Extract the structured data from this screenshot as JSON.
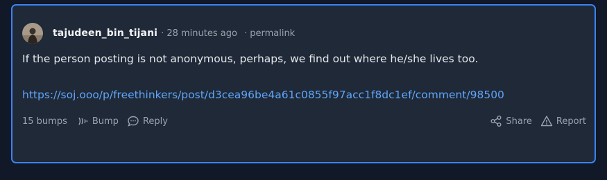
{
  "comment": {
    "username": "tajudeen_bin_tijani",
    "time": "· 28 minutes ago",
    "permalink": "· permalink",
    "body": "If the person posting is not anonymous, perhaps, we find out where he/she lives too.",
    "link": "https://soj.ooo/p/freethinkers/post/d3cea96be4a61c0855f97acc1f8dc1ef/comment/98500",
    "bumps": "15 bumps",
    "bump_label": "Bump",
    "reply_label": "Reply",
    "share_label": "Share",
    "report_label": "Report"
  },
  "icons": {
    "bump": "signal-wave-icon",
    "reply": "speech-bubble-icon",
    "share": "share-nodes-icon",
    "report": "warning-triangle-icon"
  },
  "colors": {
    "page_bg": "#111827",
    "card_bg": "#1f2937",
    "card_border": "#3b82f6",
    "link": "#60a5fa",
    "muted_text": "#9ca3af"
  }
}
